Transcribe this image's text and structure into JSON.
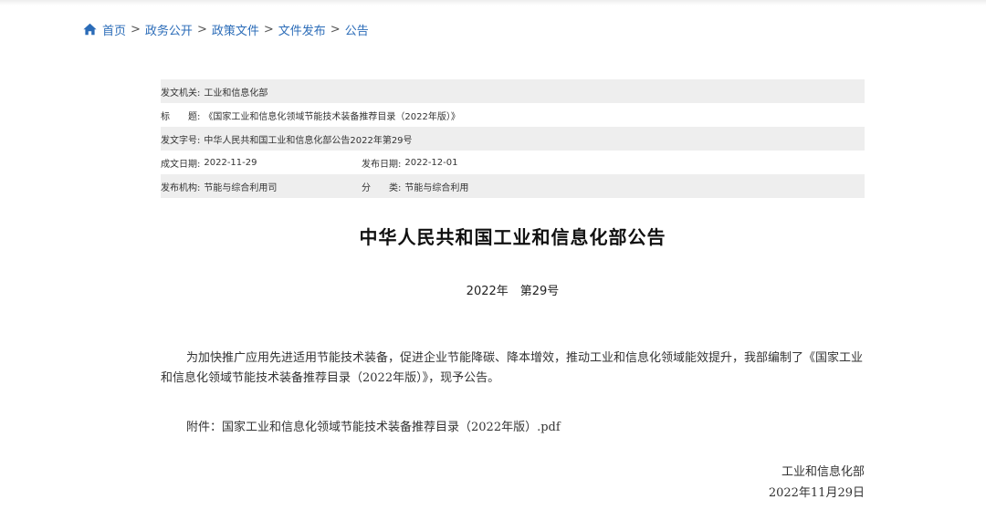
{
  "breadcrumb": {
    "items": [
      "首页",
      "政务公开",
      "政策文件",
      "文件发布",
      "公告"
    ],
    "separator": ">"
  },
  "meta": {
    "issuer_label": "发文机关:",
    "issuer_value": "工业和信息化部",
    "title_label": "标　　题:",
    "title_value": "《国家工业和信息化领域节能技术装备推荐目录（2022年版）》",
    "doc_no_label": "发文字号:",
    "doc_no_value": "中华人民共和国工业和信息化部公告2022年第29号",
    "written_date_label": "成文日期:",
    "written_date_value": "2022-11-29",
    "publish_date_label": "发布日期:",
    "publish_date_value": "2022-12-01",
    "agency_label": "发布机构:",
    "agency_value": "节能与综合利用司",
    "category_label": "分　　类:",
    "category_value": "节能与综合利用"
  },
  "document": {
    "title": "中华人民共和国工业和信息化部公告",
    "number": "2022年　第29号",
    "body": "为加快推广应用先进适用节能技术装备，促进企业节能降碳、降本增效，推动工业和信息化领域能效提升，我部编制了《国家工业和信息化领域节能技术装备推荐目录（2022年版）》，现予公告。",
    "attachment_label": "附件：",
    "attachment_name": "国家工业和信息化领域节能技术装备推荐目录（2022年版）.pdf",
    "signature_org": "工业和信息化部",
    "signature_date": "2022年11月29日"
  },
  "colors": {
    "link": "#2b6cb8",
    "row_shade": "#eeeeee"
  },
  "icons": {
    "home": "home-icon"
  }
}
